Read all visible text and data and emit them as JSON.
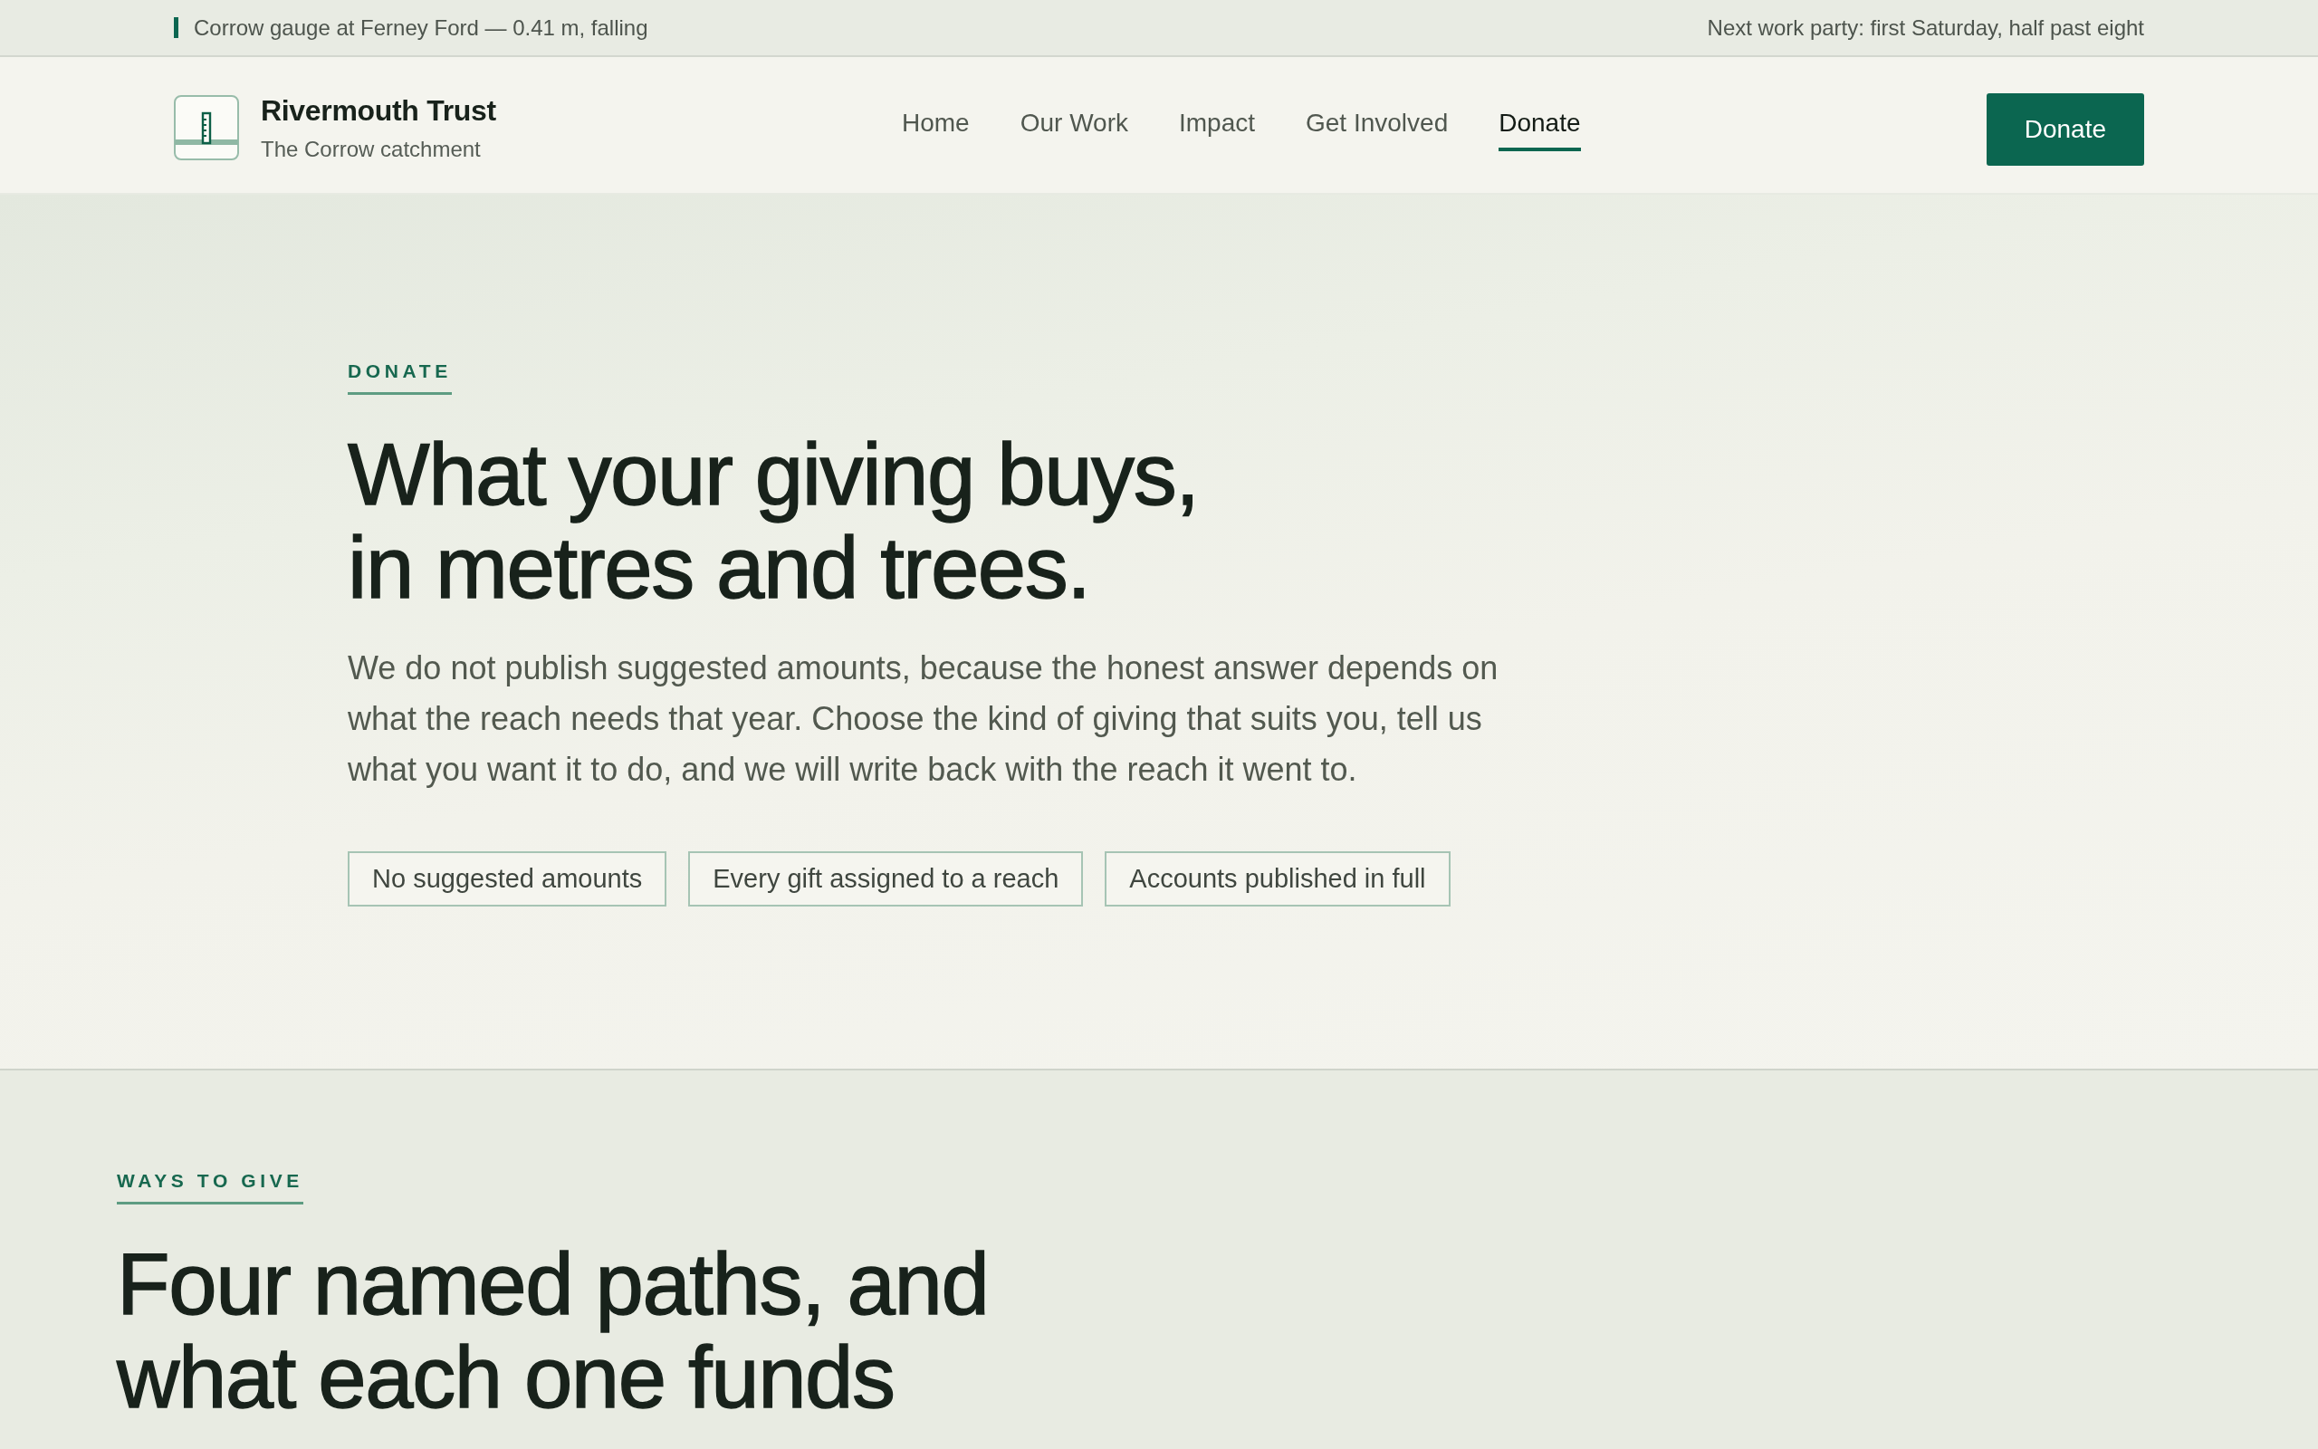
{
  "top_bar": {
    "gauge_status": "Corrow gauge at Ferney Ford — 0.41 m, falling",
    "announcement": "Next work party: first Saturday, half past eight"
  },
  "header": {
    "brand": {
      "name": "Rivermouth Trust",
      "tagline": "The Corrow catchment"
    },
    "nav": [
      {
        "label": "Home",
        "selected": false
      },
      {
        "label": "Our Work",
        "selected": false
      },
      {
        "label": "Impact",
        "selected": false
      },
      {
        "label": "Get Involved",
        "selected": false
      },
      {
        "label": "Donate",
        "selected": true
      }
    ],
    "cta_button": "Donate"
  },
  "hero": {
    "eyebrow": "DONATE",
    "heading_lines": [
      "What your giving buys,",
      "in metres and trees."
    ],
    "intro": "We do not publish suggested amounts, because the honest answer depends on what the reach needs that year. Choose the kind of giving that suits you, tell us what you want it to do, and we will write back with the reach it went to.",
    "badges": [
      "No suggested amounts",
      "Every gift assigned to a reach",
      "Accounts published in full"
    ]
  },
  "ways_to_give": {
    "eyebrow": "WAYS TO GIVE",
    "heading_lines": [
      "Four named paths, and",
      "what each one funds"
    ]
  }
}
